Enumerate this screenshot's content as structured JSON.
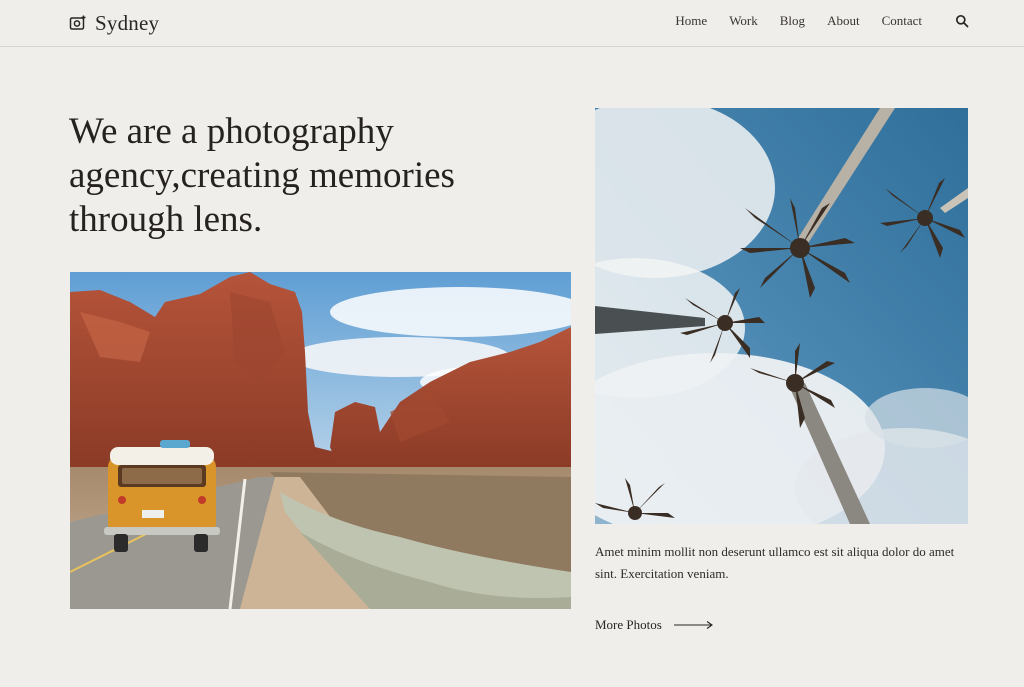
{
  "brand": {
    "name": "Sydney",
    "icon": "camera-icon"
  },
  "nav": {
    "items": [
      {
        "label": "Home"
      },
      {
        "label": "Work"
      },
      {
        "label": "Blog"
      },
      {
        "label": "About"
      },
      {
        "label": "Contact"
      }
    ],
    "search_icon": "search-icon"
  },
  "hero": {
    "title": "We are a photography agency,creating memories through lens."
  },
  "feature": {
    "caption": "Amet minim mollit non deserunt ullamco est sit aliqua dolor do amet sint. Exercitation veniam.",
    "more_label": "More Photos"
  },
  "colors": {
    "background": "#efeeea",
    "text": "#2a2622",
    "divider": "#d6d3cb"
  }
}
